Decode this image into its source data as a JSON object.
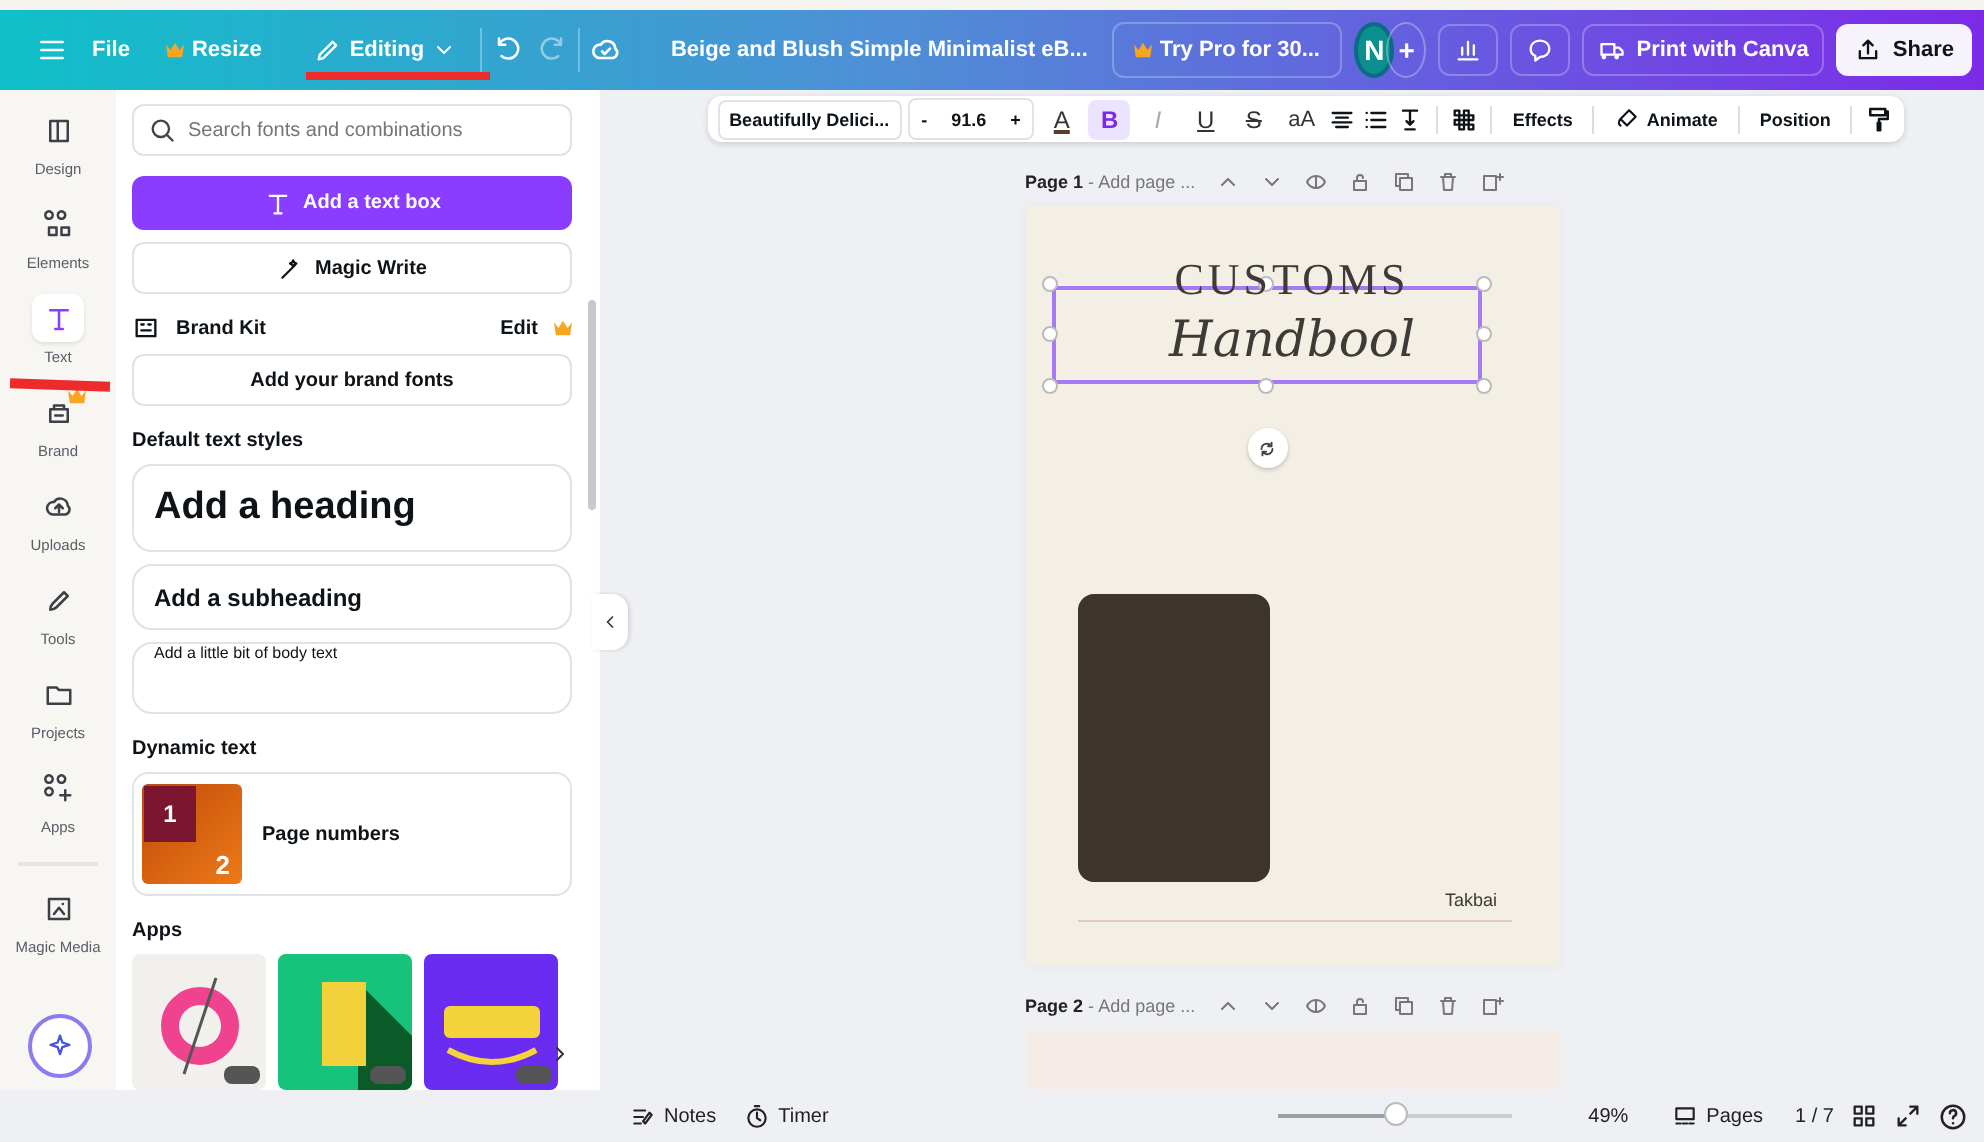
{
  "topbar": {
    "menu": [
      {
        "label": "File",
        "crown": false
      },
      {
        "label": "Resize",
        "crown": true
      }
    ],
    "mode": "Editing",
    "doc_title": "Beige and Blush Simple Minimalist eB...",
    "pro": "Try Pro for 30...",
    "avatar": "N",
    "plus": "+",
    "print": "Print with Canva",
    "share": "Share"
  },
  "rail": [
    {
      "label": "Design",
      "selected": false,
      "crown": false
    },
    {
      "label": "Elements",
      "selected": false,
      "crown": false
    },
    {
      "label": "Text",
      "selected": true,
      "crown": false
    },
    {
      "label": "Brand",
      "selected": false,
      "crown": true
    },
    {
      "label": "Uploads",
      "selected": false,
      "crown": false
    },
    {
      "label": "Tools",
      "selected": false,
      "crown": false
    },
    {
      "label": "Projects",
      "selected": false,
      "crown": false
    },
    {
      "label": "Apps",
      "selected": false,
      "crown": false
    },
    {
      "label": "Magic Media",
      "selected": false,
      "crown": false
    }
  ],
  "panel": {
    "search": {
      "placeholder": "Search fonts and combinations"
    },
    "add_text_box": "Add a text box",
    "magic_write": "Magic Write",
    "brand_kit": {
      "title": "Brand Kit",
      "edit": "Edit"
    },
    "brand_fonts": "Add your brand fonts",
    "default_styles_title": "Default text styles",
    "styles": [
      {
        "kind": "heading",
        "text": "Add a heading"
      },
      {
        "kind": "subheading",
        "text": "Add a subheading"
      },
      {
        "kind": "body",
        "text": "Add a little bit of body text"
      }
    ],
    "dynamic_title": "Dynamic text",
    "dynamic_items": [
      {
        "label": "Page numbers",
        "thumb_numbers": [
          "1",
          "2"
        ]
      }
    ],
    "apps_title": "Apps",
    "apps": [
      {
        "kind": "gradient"
      },
      {
        "kind": "block"
      },
      {
        "kind": "craft"
      }
    ]
  },
  "toolbar": {
    "font": "Beautifully Delici...",
    "minus": "-",
    "size": "91.6",
    "plus": "+",
    "format": [
      {
        "kind": "color",
        "label": "A",
        "selected": false
      },
      {
        "kind": "bold",
        "label": "B",
        "selected": true
      },
      {
        "kind": "italic",
        "label": "I",
        "selected": false
      },
      {
        "kind": "underline",
        "label": "U",
        "selected": false
      },
      {
        "kind": "strike",
        "label": "S",
        "selected": false
      },
      {
        "kind": "case",
        "label": "aA",
        "selected": false
      }
    ],
    "actions": [
      "Effects",
      "Animate",
      "Position"
    ]
  },
  "pages": [
    {
      "label": "Page 1",
      "separator": "-",
      "title_placeholder": "Add page ...",
      "design": {
        "heading": "CUSTOMS",
        "script": "Handbool",
        "footer": "Takbai"
      }
    },
    {
      "label": "Page 2",
      "separator": "-",
      "title_placeholder": "Add page ..."
    }
  ],
  "bottom": {
    "notes": "Notes",
    "timer": "Timer",
    "zoom": {
      "level": 0.5
    },
    "zoom_reading": "49%",
    "pages": "Pages",
    "page_count": "1 / 7"
  }
}
